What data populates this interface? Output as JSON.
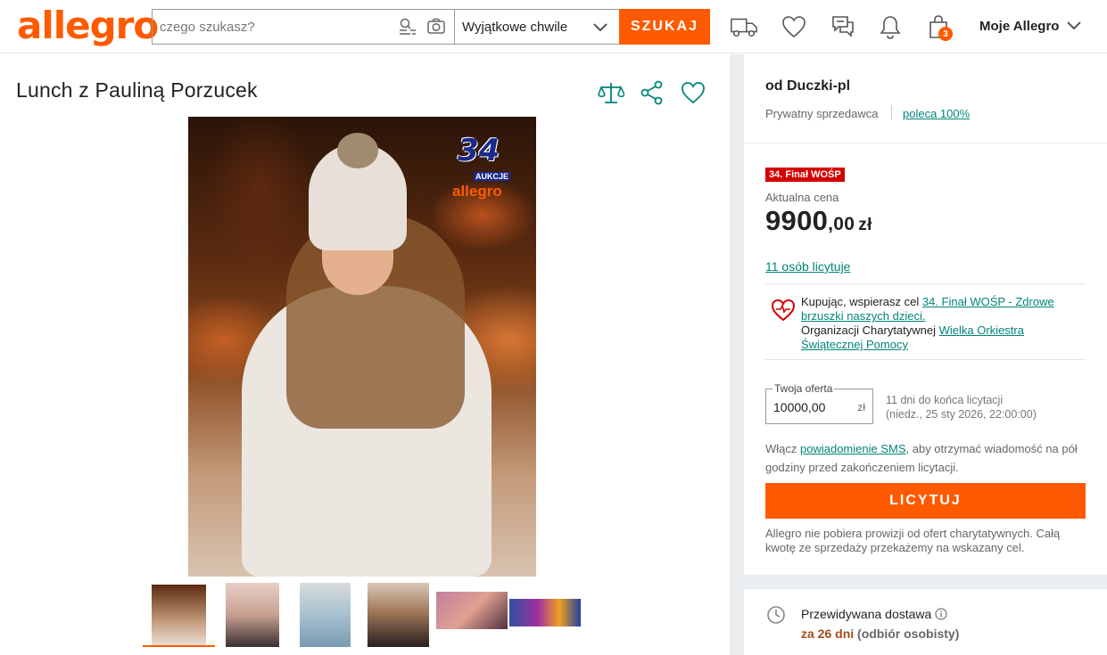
{
  "header": {
    "logo": "allegro",
    "search_placeholder": "czego szukasz?",
    "category": "Wyjątkowe chwile",
    "search_button": "SZUKAJ",
    "cart_count": "3",
    "account_label": "Moje Allegro"
  },
  "product": {
    "title": "Lunch z Pauliną Porzucek",
    "badge_number": "34",
    "badge_sub": "AUKCJE",
    "badge_brand": "allegro"
  },
  "seller": {
    "name": "od Duczki-pl",
    "type": "Prywatny sprzedawca",
    "recommend": "poleca 100%"
  },
  "offer": {
    "badge": "34. Finał WOŚP",
    "price_label": "Aktualna cena",
    "price_int": "9900",
    "price_dec": ",00",
    "currency": "zł",
    "bidders": "11 osób licytuje",
    "charity_prefix": "Kupując, wspierasz cel ",
    "charity_goal": "34. Finał WOŚP - Zdrowe brzuszki naszych dzieci.",
    "charity_org_prefix": "Organizacji Charytatywnej ",
    "charity_org": "Wielka Orkiestra Świątecznej Pomocy",
    "your_offer_label": "Twoja oferta",
    "your_offer_value": "10000,00",
    "your_offer_unit": "zł",
    "time_left": "11 dni do końca licytacji",
    "end_date": "(niedz., 25 sty 2026, 22:00:00)",
    "sms_prefix": "Włącz ",
    "sms_link": "powiadomienie SMS",
    "sms_suffix": ", aby otrzymać wiadomość na pół godziny przed zakończeniem licytacji.",
    "bid_button": "LICYTUJ",
    "note": "Allegro nie pobiera prowizji od ofert charytatywnych. Całą kwotę ze sprzedaży przekażemy na wskazany cel."
  },
  "shipping": {
    "label": "Przewidywana dostawa",
    "time_highlight": "za 26 dni",
    "time_suffix": " (odbiór osobisty)"
  },
  "colors": {
    "accent": "#ff5a00",
    "link": "#00857a",
    "wosp_red": "#d50000"
  }
}
